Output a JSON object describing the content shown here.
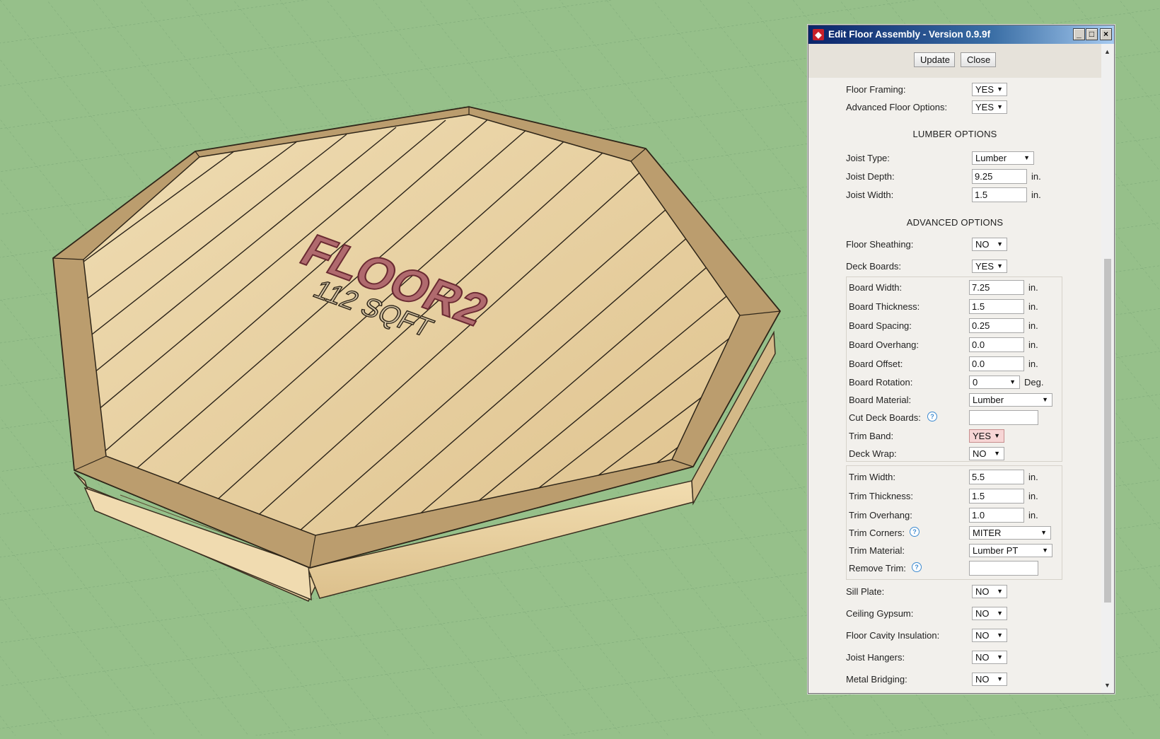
{
  "model": {
    "floor_name": "FLOOR2",
    "area_label": "112 SQFT"
  },
  "dialog": {
    "title": "Edit Floor Assembly - Version 0.9.9f",
    "update_label": "Update",
    "close_label": "Close"
  },
  "general": {
    "floor_framing": {
      "label": "Floor Framing:",
      "value": "YES"
    },
    "advanced_floor_options": {
      "label": "Advanced Floor Options:",
      "value": "YES"
    }
  },
  "lumber": {
    "heading": "LUMBER OPTIONS",
    "joist_type": {
      "label": "Joist Type:",
      "value": "Lumber"
    },
    "joist_depth": {
      "label": "Joist Depth:",
      "value": "9.25",
      "unit": "in."
    },
    "joist_width": {
      "label": "Joist Width:",
      "value": "1.5",
      "unit": "in."
    }
  },
  "advanced": {
    "heading": "ADVANCED OPTIONS",
    "floor_sheathing": {
      "label": "Floor Sheathing:",
      "value": "NO"
    },
    "deck_boards": {
      "label": "Deck Boards:",
      "value": "YES"
    },
    "board_width": {
      "label": "Board Width:",
      "value": "7.25",
      "unit": "in."
    },
    "board_thickness": {
      "label": "Board Thickness:",
      "value": "1.5",
      "unit": "in."
    },
    "board_spacing": {
      "label": "Board Spacing:",
      "value": "0.25",
      "unit": "in."
    },
    "board_overhang": {
      "label": "Board Overhang:",
      "value": "0.0",
      "unit": "in."
    },
    "board_offset": {
      "label": "Board Offset:",
      "value": "0.0",
      "unit": "in."
    },
    "board_rotation": {
      "label": "Board Rotation:",
      "value": "0",
      "unit": "Deg."
    },
    "board_material": {
      "label": "Board Material:",
      "value": "Lumber"
    },
    "cut_deck_boards": {
      "label": "Cut Deck Boards:",
      "value": ""
    },
    "trim_band": {
      "label": "Trim Band:",
      "value": "YES"
    },
    "deck_wrap": {
      "label": "Deck Wrap:",
      "value": "NO"
    },
    "trim_width": {
      "label": "Trim Width:",
      "value": "5.5",
      "unit": "in."
    },
    "trim_thickness": {
      "label": "Trim Thickness:",
      "value": "1.5",
      "unit": "in."
    },
    "trim_overhang": {
      "label": "Trim Overhang:",
      "value": "1.0",
      "unit": "in."
    },
    "trim_corners": {
      "label": "Trim Corners:",
      "value": "MITER"
    },
    "trim_material": {
      "label": "Trim Material:",
      "value": "Lumber PT"
    },
    "remove_trim": {
      "label": "Remove Trim:",
      "value": ""
    },
    "sill_plate": {
      "label": "Sill Plate:",
      "value": "NO"
    },
    "ceiling_gypsum": {
      "label": "Ceiling Gypsum:",
      "value": "NO"
    },
    "floor_cavity_insulation": {
      "label": "Floor Cavity Insulation:",
      "value": "NO"
    },
    "joist_hangers": {
      "label": "Joist Hangers:",
      "value": "NO"
    },
    "metal_bridging": {
      "label": "Metal Bridging:",
      "value": "NO"
    }
  },
  "colors": {
    "ground": "#96c08a",
    "deck": "#e6cfa1",
    "trim": "#b89a6c",
    "label_text": "#8c3a44"
  }
}
